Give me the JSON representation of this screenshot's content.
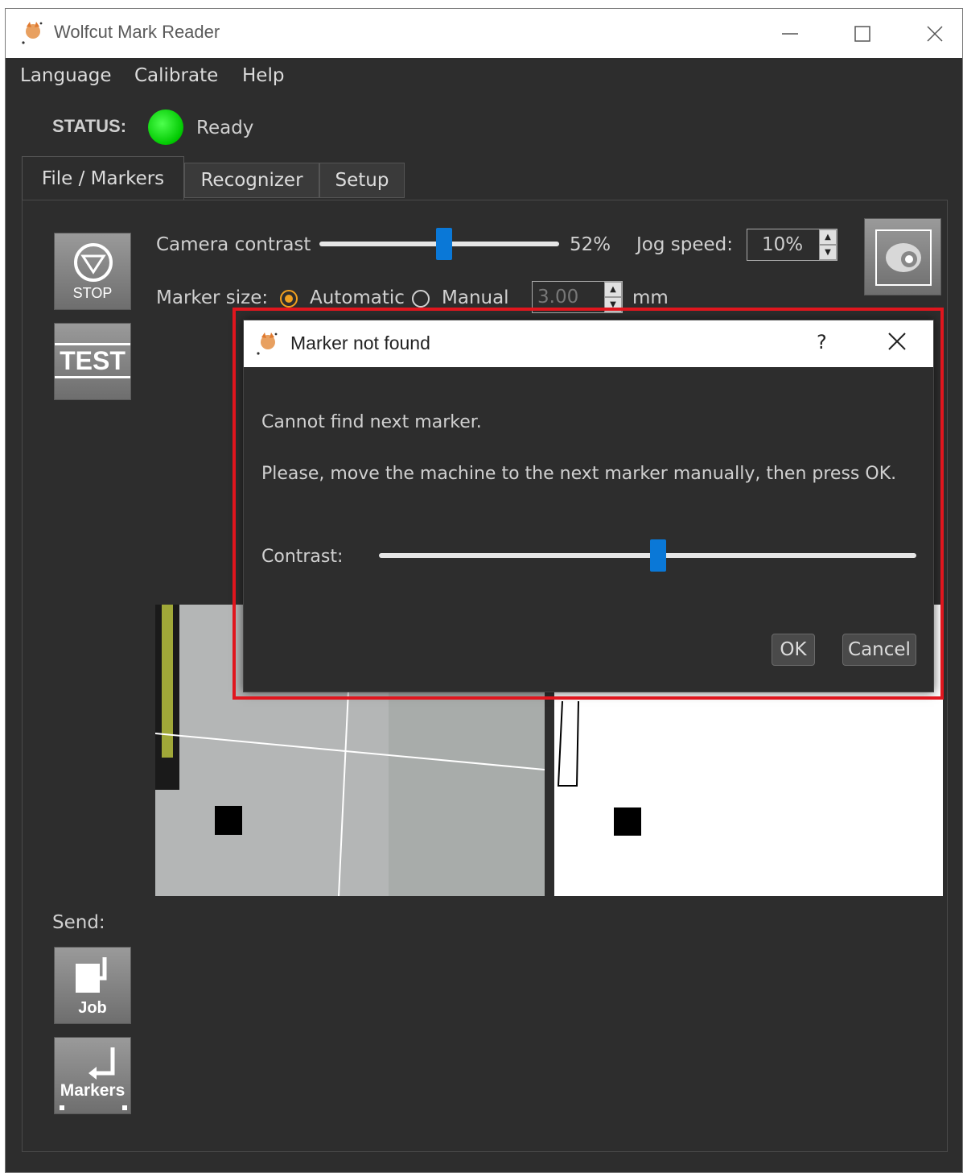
{
  "window": {
    "title": "Wolfcut Mark Reader"
  },
  "menu": {
    "items": [
      "Language",
      "Calibrate",
      "Help"
    ]
  },
  "status": {
    "label": "STATUS:",
    "text": "Ready",
    "color": "#00c800"
  },
  "tabs": [
    "File / Markers",
    "Recognizer",
    "Setup"
  ],
  "toolbar": {
    "stop_label": "STOP",
    "test_label": "TEST",
    "camera_contrast_label": "Camera contrast",
    "camera_contrast_value": "52%",
    "camera_contrast_percent": 52,
    "jog_speed_label": "Jog speed:",
    "jog_speed_value": "10%",
    "marker_size_label": "Marker size:",
    "automatic_label": "Automatic",
    "manual_label": "Manual",
    "marker_size_value": "3.00",
    "unit_label": "mm",
    "selected_mode": "Automatic"
  },
  "send": {
    "label": "Send:",
    "job_label": "Job",
    "markers_label": "Markers"
  },
  "dialog": {
    "title": "Marker not found",
    "help": "?",
    "message1": "Cannot find next marker.",
    "message2": "Please, move the machine to the next marker manually, then press OK.",
    "contrast_label": "Contrast:",
    "contrast_percent": 52,
    "ok_label": "OK",
    "cancel_label": "Cancel"
  },
  "colors": {
    "accent": "#0a78d7",
    "highlight_box": "#e0161e",
    "radio_selected": "#f0a020"
  }
}
